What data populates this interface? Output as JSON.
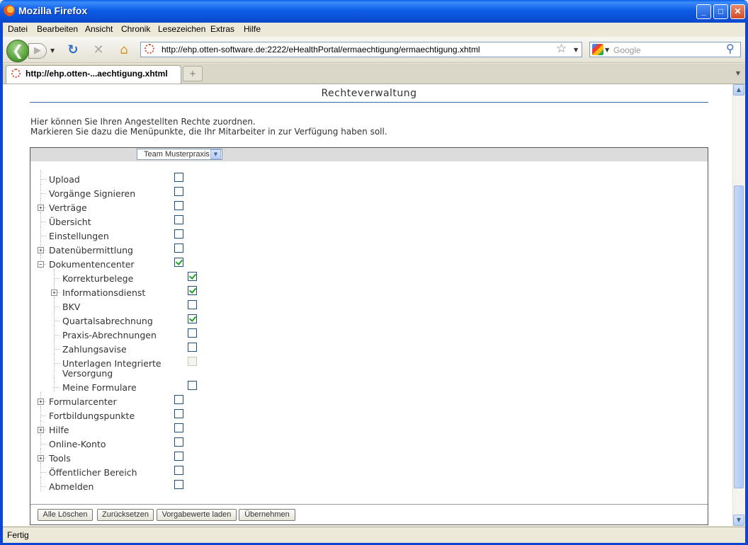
{
  "window": {
    "title": "Mozilla Firefox"
  },
  "menu": [
    "Datei",
    "Bearbeiten",
    "Ansicht",
    "Chronik",
    "Lesezeichen",
    "Extras",
    "Hilfe"
  ],
  "nav": {
    "url": "http://ehp.otten-software.de:2222/eHealthPortal/ermaechtigung/ermaechtigung.xhtml",
    "search_placeholder": "Google"
  },
  "tab": {
    "label": "http://ehp.otten-...aechtigung.xhtml"
  },
  "page": {
    "heading": "Rechteverwaltung",
    "description": [
      "Hier können Sie Ihren Angestellten Rechte zuordnen.",
      "Markieren Sie dazu die Menüpunkte, die Ihr Mitarbeiter in zur Verfügung haben soll."
    ],
    "team_select": "Team Musterpraxis",
    "tree": [
      {
        "label": "Upload",
        "level": 0,
        "expander": "",
        "checked": false,
        "disabled": false
      },
      {
        "label": "Vorgänge Signieren",
        "level": 0,
        "expander": "",
        "checked": false,
        "disabled": false
      },
      {
        "label": "Verträge",
        "level": 0,
        "expander": "+",
        "checked": false,
        "disabled": false
      },
      {
        "label": "Übersicht",
        "level": 0,
        "expander": "",
        "checked": false,
        "disabled": false
      },
      {
        "label": "Einstellungen",
        "level": 0,
        "expander": "",
        "checked": false,
        "disabled": false
      },
      {
        "label": "Datenübermittlung",
        "level": 0,
        "expander": "+",
        "checked": false,
        "disabled": false
      },
      {
        "label": "Dokumentencenter",
        "level": 0,
        "expander": "-",
        "checked": true,
        "disabled": false
      },
      {
        "label": "Korrekturbelege",
        "level": 1,
        "expander": "",
        "checked": true,
        "disabled": false
      },
      {
        "label": "Informationsdienst",
        "level": 1,
        "expander": "+",
        "checked": true,
        "disabled": false
      },
      {
        "label": "BKV",
        "level": 1,
        "expander": "",
        "checked": false,
        "disabled": false
      },
      {
        "label": "Quartalsabrechnung",
        "level": 1,
        "expander": "",
        "checked": true,
        "disabled": false
      },
      {
        "label": "Praxis-Abrechnungen",
        "level": 1,
        "expander": "",
        "checked": false,
        "disabled": false
      },
      {
        "label": "Zahlungsavise",
        "level": 1,
        "expander": "",
        "checked": false,
        "disabled": false
      },
      {
        "label": "Unterlagen Integrierte",
        "label2": "Versorgung",
        "level": 1,
        "expander": "",
        "checked": false,
        "disabled": true
      },
      {
        "label": "Meine Formulare",
        "level": 1,
        "expander": "",
        "checked": false,
        "disabled": false
      },
      {
        "label": "Formularcenter",
        "level": 0,
        "expander": "+",
        "checked": false,
        "disabled": false
      },
      {
        "label": "Fortbildungspunkte",
        "level": 0,
        "expander": "",
        "checked": false,
        "disabled": false
      },
      {
        "label": "Hilfe",
        "level": 0,
        "expander": "+",
        "checked": false,
        "disabled": false
      },
      {
        "label": "Online-Konto",
        "level": 0,
        "expander": "",
        "checked": false,
        "disabled": false
      },
      {
        "label": "Tools",
        "level": 0,
        "expander": "+",
        "checked": false,
        "disabled": false
      },
      {
        "label": "Öffentlicher Bereich",
        "level": 0,
        "expander": "",
        "checked": false,
        "disabled": false
      },
      {
        "label": "Abmelden",
        "level": 0,
        "expander": "",
        "checked": false,
        "disabled": false
      }
    ],
    "buttons": [
      "Alle Löschen",
      "Zurücksetzen",
      "Vorgabewerte laden",
      "Übernehmen"
    ]
  },
  "status": "Fertig",
  "colors": {
    "title_bar": "#0A5FE8",
    "heading_rule": "#37659A",
    "check": "#21A121"
  }
}
